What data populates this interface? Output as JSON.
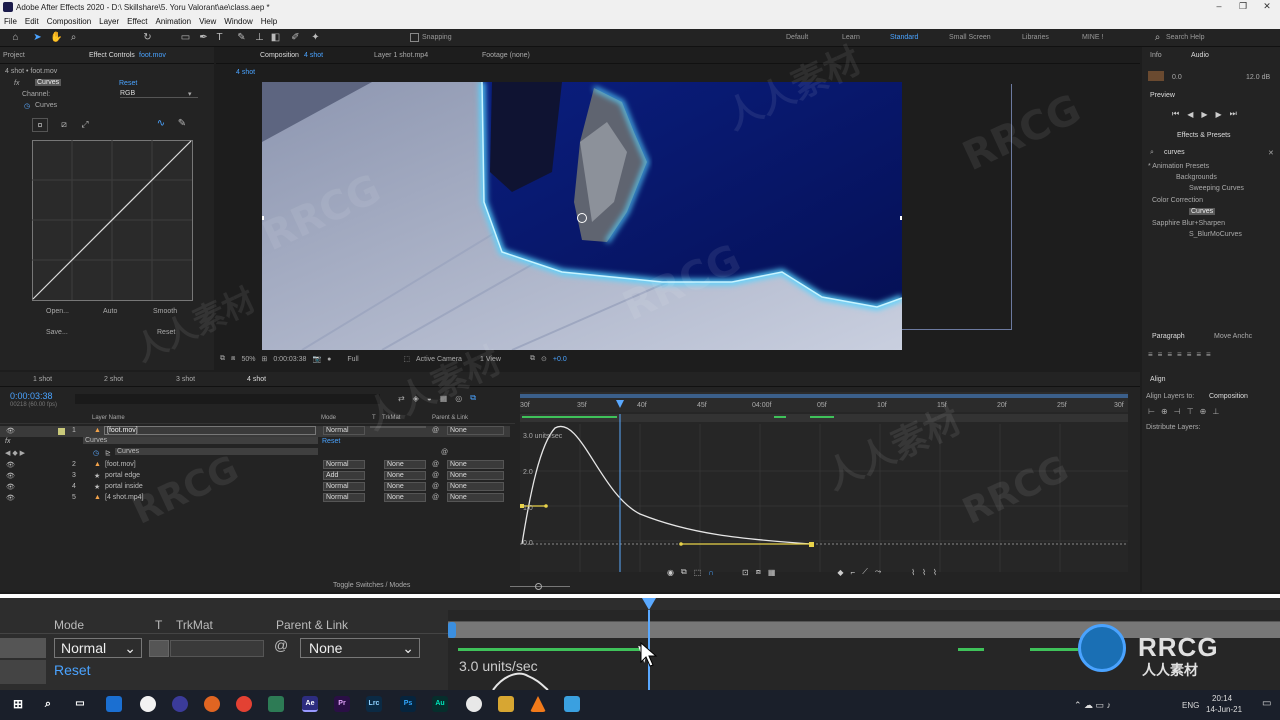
{
  "titlebar": {
    "title": "Adobe After Effects 2020 - D:\\ Skillshare\\5. Yoru Valorant\\ae\\class.aep *"
  },
  "menu": [
    "File",
    "Edit",
    "Composition",
    "Layer",
    "Effect",
    "Animation",
    "View",
    "Window",
    "Help"
  ],
  "toolbar": {
    "snapping": "Snapping",
    "workspaces": [
      "Default",
      "Learn",
      "Standard",
      "Small Screen",
      "Libraries",
      "MINE !"
    ],
    "search_placeholder": "Search Help"
  },
  "project_panel": {
    "tab_project": "Project",
    "tab_effect_controls": "Effect Controls",
    "effect_target": "foot.mov",
    "breadcrumb": "4 shot • foot.mov",
    "effect_name": "Curves",
    "reset": "Reset",
    "channel_label": "Channel:",
    "channel_value": "RGB",
    "curves_label": "Curves",
    "buttons": [
      "Open...",
      "Auto",
      "Smooth",
      "Save...",
      "Reset"
    ]
  },
  "composition": {
    "tab_comp": "Composition",
    "comp_name": "4 shot",
    "tab_layer": "Layer  1 shot.mp4",
    "tab_footage": "Footage  (none)",
    "comp_tab": "4 shot",
    "zoom": "50%",
    "timecode": "0:00:03:38",
    "resolution": "Full",
    "camera": "Active Camera",
    "views": "1 View",
    "exposure": "+0.0"
  },
  "timeline": {
    "tabs": [
      "1 shot",
      "2 shot",
      "3 shot",
      "4 shot"
    ],
    "timecode": "0:00:03:38",
    "fps": "00218 (60.00 fps)",
    "headers": {
      "layer_name": "Layer Name",
      "mode": "Mode",
      "t": "T",
      "trkmat": "TrkMat",
      "parent": "Parent & Link"
    },
    "layers": [
      {
        "num": "1",
        "name": "[foot.mov]",
        "mode": "Normal",
        "trkmat": "",
        "parent": "None",
        "color": "#c9c97a"
      },
      {
        "num": "2",
        "name": "[foot.mov]",
        "mode": "Normal",
        "trkmat": "None",
        "parent": "None",
        "color": "#c9c97a"
      },
      {
        "num": "3",
        "name": "portal edge",
        "mode": "Add",
        "trkmat": "None",
        "parent": "None",
        "color": "#d8a0d0"
      },
      {
        "num": "4",
        "name": "portal inside",
        "mode": "Normal",
        "trkmat": "None",
        "parent": "None",
        "color": "#d8a0d0"
      },
      {
        "num": "5",
        "name": "[4 shot.mp4]",
        "mode": "Normal",
        "trkmat": "None",
        "parent": "None",
        "color": "#c9c97a"
      }
    ],
    "effect_row": "Curves",
    "effect_reset": "Reset",
    "curves_row": "Curves",
    "ruler": [
      "30f",
      "35f",
      "40f",
      "45f",
      "04:00f",
      "05f",
      "10f",
      "15f",
      "20f",
      "25f",
      "30f"
    ],
    "graph_labels": [
      "3.0 units/sec",
      "2.0",
      "1.0",
      "0.0"
    ],
    "toggle": "Toggle Switches / Modes"
  },
  "right_panel": {
    "info": "Info",
    "audio": "Audio",
    "audio_left": "0.0",
    "audio_right": "12.0 dB",
    "preview": "Preview",
    "effects_presets": "Effects & Presets",
    "search_value": "curves",
    "tree": [
      {
        "label": "* Animation Presets",
        "indent": 0
      },
      {
        "label": "Backgrounds",
        "indent": 1
      },
      {
        "label": "Sweeping Curves",
        "indent": 2
      },
      {
        "label": "Color Correction",
        "indent": 0
      },
      {
        "label": "Curves",
        "indent": 2
      },
      {
        "label": "Sapphire Blur+Sharpen",
        "indent": 0
      },
      {
        "label": "S_BlurMoCurves",
        "indent": 2
      }
    ],
    "paragraph": "Paragraph",
    "move_anchor": "Move Anchc",
    "align": "Align",
    "align_to_label": "Align Layers to:",
    "align_to_value": "Composition",
    "distribute": "Distribute Layers:"
  },
  "zoomed": {
    "mode": "Mode",
    "t": "T",
    "trkmat": "TrkMat",
    "parent": "Parent & Link",
    "mode_value": "Normal",
    "parent_value": "None",
    "reset": "Reset",
    "units": "3.0 units/sec"
  },
  "watermark": {
    "brand": "RRCG",
    "cn": "人人素材"
  },
  "taskbar": {
    "apps": [
      "Ae",
      "Pr",
      "Lrc",
      "Ps",
      "Au"
    ],
    "lang": "ENG",
    "time": "20:14",
    "date": "14-Jun-21"
  },
  "colors": {
    "accent": "#2d8ceb",
    "timecode": "#4aa3ff",
    "glow": "#57d3ff",
    "keyframe": "#e9d34a"
  }
}
